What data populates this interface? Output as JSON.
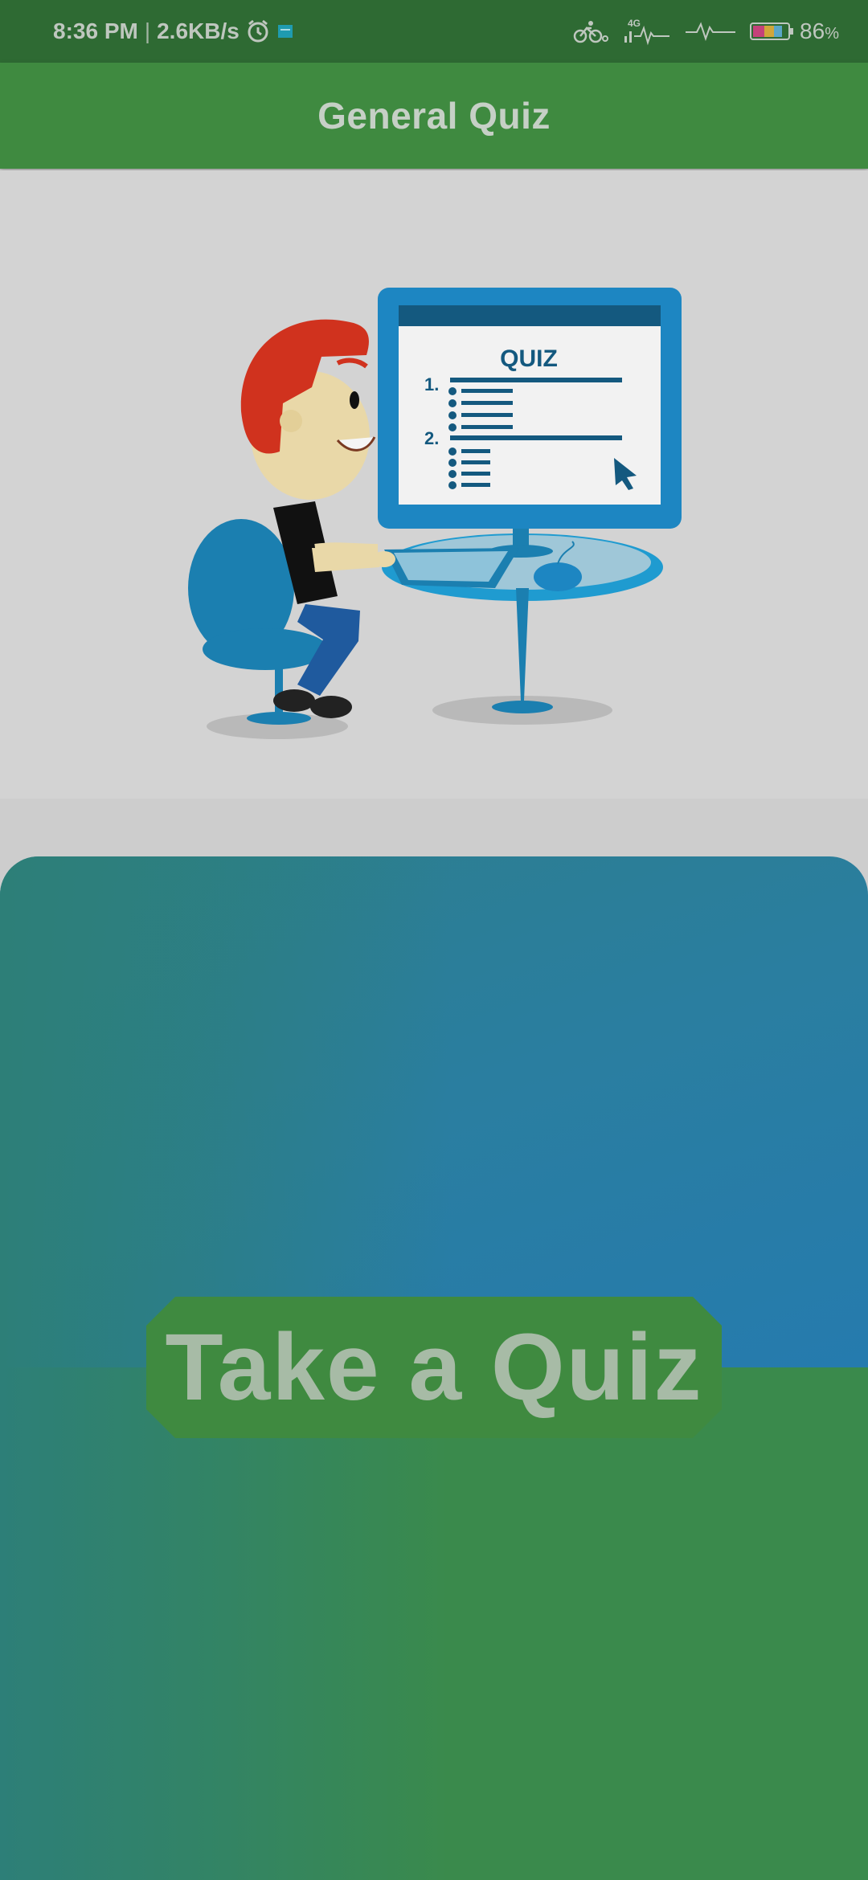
{
  "status_bar": {
    "time": "8:36 PM",
    "separator": "|",
    "speed": "2.6KB/s",
    "network": "4G",
    "battery_percent": "86",
    "battery_unit": "%",
    "icons": [
      "alarm-icon",
      "notification-icon",
      "cycling-icon",
      "signal-icon",
      "activity-icon",
      "battery-icon"
    ]
  },
  "app_bar": {
    "title": "General Quiz"
  },
  "illustration": {
    "screen_heading": "QUIZ",
    "item_1": "1.",
    "item_2": "2."
  },
  "quiz_button": {
    "label": "Take a Quiz"
  },
  "colors": {
    "status_bar": "#2e6a33",
    "app_bar": "#3f8a40",
    "card_top": "#2a7ea0",
    "card_bottom_green": "#3a8a4c",
    "button": "#3f8a40"
  }
}
